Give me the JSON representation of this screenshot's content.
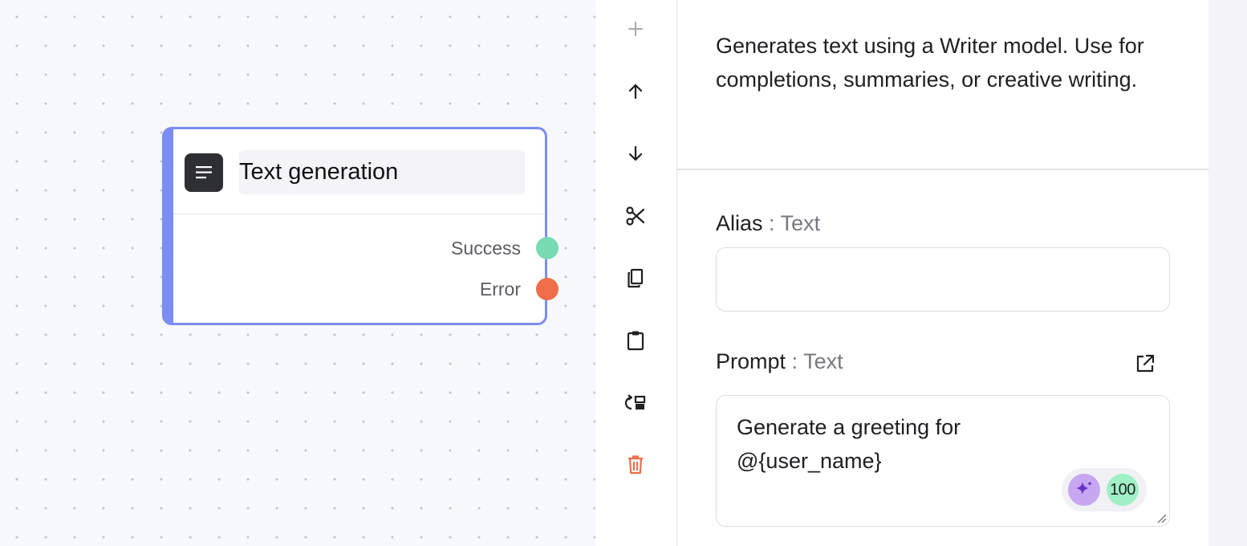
{
  "node": {
    "title": "Text generation",
    "outputs": [
      {
        "label": "Success",
        "color": "#77dbb3"
      },
      {
        "label": "Error",
        "color": "#ee6e4a"
      }
    ],
    "icon": "lines-icon",
    "accent": "#7b8cf2"
  },
  "toolbar": {
    "buttons": [
      {
        "name": "add",
        "icon": "plus-icon"
      },
      {
        "name": "move-up",
        "icon": "arrow-up-icon"
      },
      {
        "name": "move-down",
        "icon": "arrow-down-icon"
      },
      {
        "name": "cut",
        "icon": "scissors-icon"
      },
      {
        "name": "copy",
        "icon": "copy-icon"
      },
      {
        "name": "paste",
        "icon": "clipboard-icon"
      },
      {
        "name": "replace",
        "icon": "swap-icon"
      },
      {
        "name": "delete",
        "icon": "trash-icon",
        "color": "#ee6e4a"
      }
    ]
  },
  "panel": {
    "description": "Generates text using a Writer model. Use for completions, summaries, or creative writing.",
    "alias": {
      "label": "Alias",
      "sep": " : ",
      "type": "Text",
      "value": ""
    },
    "prompt": {
      "label": "Prompt",
      "sep": " : ",
      "type": "Text",
      "value": "Generate a greeting for\n@{user_name}",
      "ai_count": "100"
    }
  }
}
